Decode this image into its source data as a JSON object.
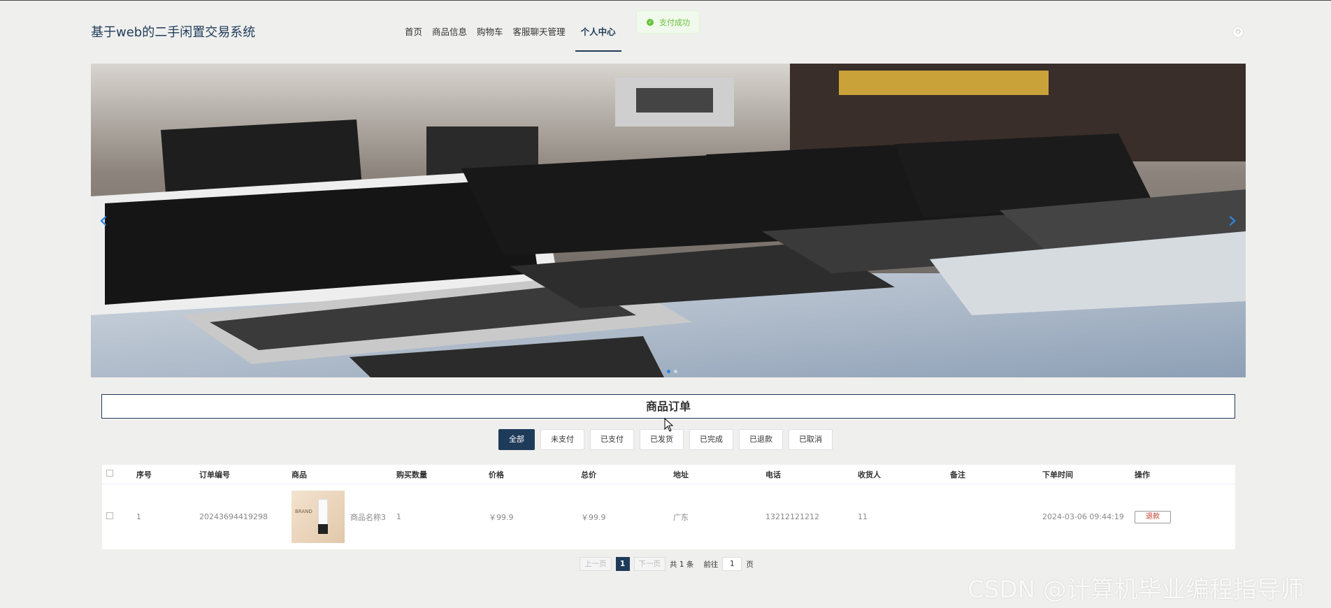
{
  "header": {
    "site_title": "基于web的二手闲置交易系统",
    "nav": [
      "首页",
      "商品信息",
      "购物车",
      "客服聊天管理",
      "个人中心"
    ],
    "active_nav": "个人中心",
    "toast": "支付成功",
    "toast_color": "#67c23a",
    "power_icon": "power-icon"
  },
  "banner": {
    "prev_icon": "chevron-left-icon",
    "next_icon": "chevron-right-icon",
    "slides": 2,
    "active_slide": 1
  },
  "orders": {
    "section_title": "商品订单",
    "tabs": [
      "全部",
      "未支付",
      "已支付",
      "已发货",
      "已完成",
      "已退款",
      "已取消"
    ],
    "active_tab": "全部",
    "columns": [
      "序号",
      "订单编号",
      "商品",
      "购买数量",
      "价格",
      "总价",
      "地址",
      "电话",
      "收货人",
      "备注",
      "下单时间",
      "操作"
    ],
    "rows": [
      {
        "index": "1",
        "order_no": "20243694419298",
        "goods_name": "商品名称3",
        "thumb_text": "BRAND",
        "qty": "1",
        "price": "￥99.9",
        "total": "￥99.9",
        "address": "广东",
        "phone": "13212121212",
        "receiver": "11",
        "note": "",
        "time": "2024-03-06 09:44:19",
        "action": "退款"
      }
    ]
  },
  "pagination": {
    "prev": "上一页",
    "current": "1",
    "next": "下一页",
    "total": "共 1 条",
    "goto_label": "前往",
    "goto_value": "1",
    "page_suffix": "页"
  },
  "watermark": "CSDN @计算机毕业编程指导师",
  "accent_color": "#1f3b5a"
}
